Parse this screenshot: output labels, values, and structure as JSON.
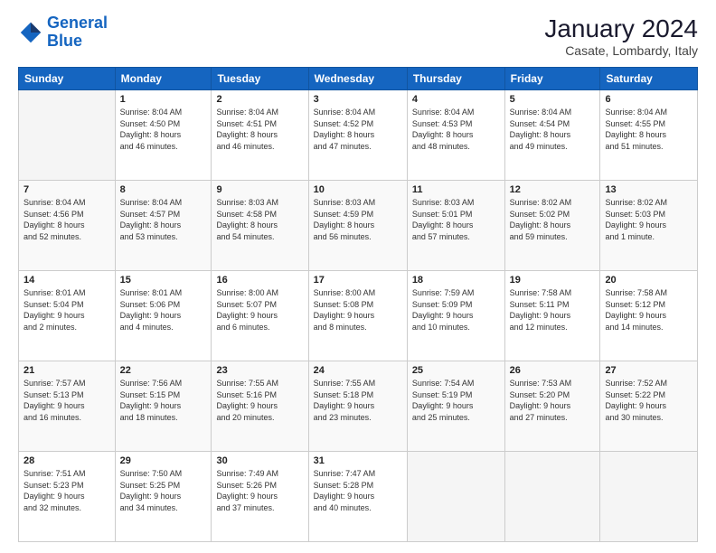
{
  "header": {
    "logo_line1": "General",
    "logo_line2": "Blue",
    "main_title": "January 2024",
    "subtitle": "Casate, Lombardy, Italy"
  },
  "days_of_week": [
    "Sunday",
    "Monday",
    "Tuesday",
    "Wednesday",
    "Thursday",
    "Friday",
    "Saturday"
  ],
  "weeks": [
    [
      {
        "day": "",
        "info": ""
      },
      {
        "day": "1",
        "info": "Sunrise: 8:04 AM\nSunset: 4:50 PM\nDaylight: 8 hours\nand 46 minutes."
      },
      {
        "day": "2",
        "info": "Sunrise: 8:04 AM\nSunset: 4:51 PM\nDaylight: 8 hours\nand 46 minutes."
      },
      {
        "day": "3",
        "info": "Sunrise: 8:04 AM\nSunset: 4:52 PM\nDaylight: 8 hours\nand 47 minutes."
      },
      {
        "day": "4",
        "info": "Sunrise: 8:04 AM\nSunset: 4:53 PM\nDaylight: 8 hours\nand 48 minutes."
      },
      {
        "day": "5",
        "info": "Sunrise: 8:04 AM\nSunset: 4:54 PM\nDaylight: 8 hours\nand 49 minutes."
      },
      {
        "day": "6",
        "info": "Sunrise: 8:04 AM\nSunset: 4:55 PM\nDaylight: 8 hours\nand 51 minutes."
      }
    ],
    [
      {
        "day": "7",
        "info": "Sunrise: 8:04 AM\nSunset: 4:56 PM\nDaylight: 8 hours\nand 52 minutes."
      },
      {
        "day": "8",
        "info": "Sunrise: 8:04 AM\nSunset: 4:57 PM\nDaylight: 8 hours\nand 53 minutes."
      },
      {
        "day": "9",
        "info": "Sunrise: 8:03 AM\nSunset: 4:58 PM\nDaylight: 8 hours\nand 54 minutes."
      },
      {
        "day": "10",
        "info": "Sunrise: 8:03 AM\nSunset: 4:59 PM\nDaylight: 8 hours\nand 56 minutes."
      },
      {
        "day": "11",
        "info": "Sunrise: 8:03 AM\nSunset: 5:01 PM\nDaylight: 8 hours\nand 57 minutes."
      },
      {
        "day": "12",
        "info": "Sunrise: 8:02 AM\nSunset: 5:02 PM\nDaylight: 8 hours\nand 59 minutes."
      },
      {
        "day": "13",
        "info": "Sunrise: 8:02 AM\nSunset: 5:03 PM\nDaylight: 9 hours\nand 1 minute."
      }
    ],
    [
      {
        "day": "14",
        "info": "Sunrise: 8:01 AM\nSunset: 5:04 PM\nDaylight: 9 hours\nand 2 minutes."
      },
      {
        "day": "15",
        "info": "Sunrise: 8:01 AM\nSunset: 5:06 PM\nDaylight: 9 hours\nand 4 minutes."
      },
      {
        "day": "16",
        "info": "Sunrise: 8:00 AM\nSunset: 5:07 PM\nDaylight: 9 hours\nand 6 minutes."
      },
      {
        "day": "17",
        "info": "Sunrise: 8:00 AM\nSunset: 5:08 PM\nDaylight: 9 hours\nand 8 minutes."
      },
      {
        "day": "18",
        "info": "Sunrise: 7:59 AM\nSunset: 5:09 PM\nDaylight: 9 hours\nand 10 minutes."
      },
      {
        "day": "19",
        "info": "Sunrise: 7:58 AM\nSunset: 5:11 PM\nDaylight: 9 hours\nand 12 minutes."
      },
      {
        "day": "20",
        "info": "Sunrise: 7:58 AM\nSunset: 5:12 PM\nDaylight: 9 hours\nand 14 minutes."
      }
    ],
    [
      {
        "day": "21",
        "info": "Sunrise: 7:57 AM\nSunset: 5:13 PM\nDaylight: 9 hours\nand 16 minutes."
      },
      {
        "day": "22",
        "info": "Sunrise: 7:56 AM\nSunset: 5:15 PM\nDaylight: 9 hours\nand 18 minutes."
      },
      {
        "day": "23",
        "info": "Sunrise: 7:55 AM\nSunset: 5:16 PM\nDaylight: 9 hours\nand 20 minutes."
      },
      {
        "day": "24",
        "info": "Sunrise: 7:55 AM\nSunset: 5:18 PM\nDaylight: 9 hours\nand 23 minutes."
      },
      {
        "day": "25",
        "info": "Sunrise: 7:54 AM\nSunset: 5:19 PM\nDaylight: 9 hours\nand 25 minutes."
      },
      {
        "day": "26",
        "info": "Sunrise: 7:53 AM\nSunset: 5:20 PM\nDaylight: 9 hours\nand 27 minutes."
      },
      {
        "day": "27",
        "info": "Sunrise: 7:52 AM\nSunset: 5:22 PM\nDaylight: 9 hours\nand 30 minutes."
      }
    ],
    [
      {
        "day": "28",
        "info": "Sunrise: 7:51 AM\nSunset: 5:23 PM\nDaylight: 9 hours\nand 32 minutes."
      },
      {
        "day": "29",
        "info": "Sunrise: 7:50 AM\nSunset: 5:25 PM\nDaylight: 9 hours\nand 34 minutes."
      },
      {
        "day": "30",
        "info": "Sunrise: 7:49 AM\nSunset: 5:26 PM\nDaylight: 9 hours\nand 37 minutes."
      },
      {
        "day": "31",
        "info": "Sunrise: 7:47 AM\nSunset: 5:28 PM\nDaylight: 9 hours\nand 40 minutes."
      },
      {
        "day": "",
        "info": ""
      },
      {
        "day": "",
        "info": ""
      },
      {
        "day": "",
        "info": ""
      }
    ]
  ]
}
